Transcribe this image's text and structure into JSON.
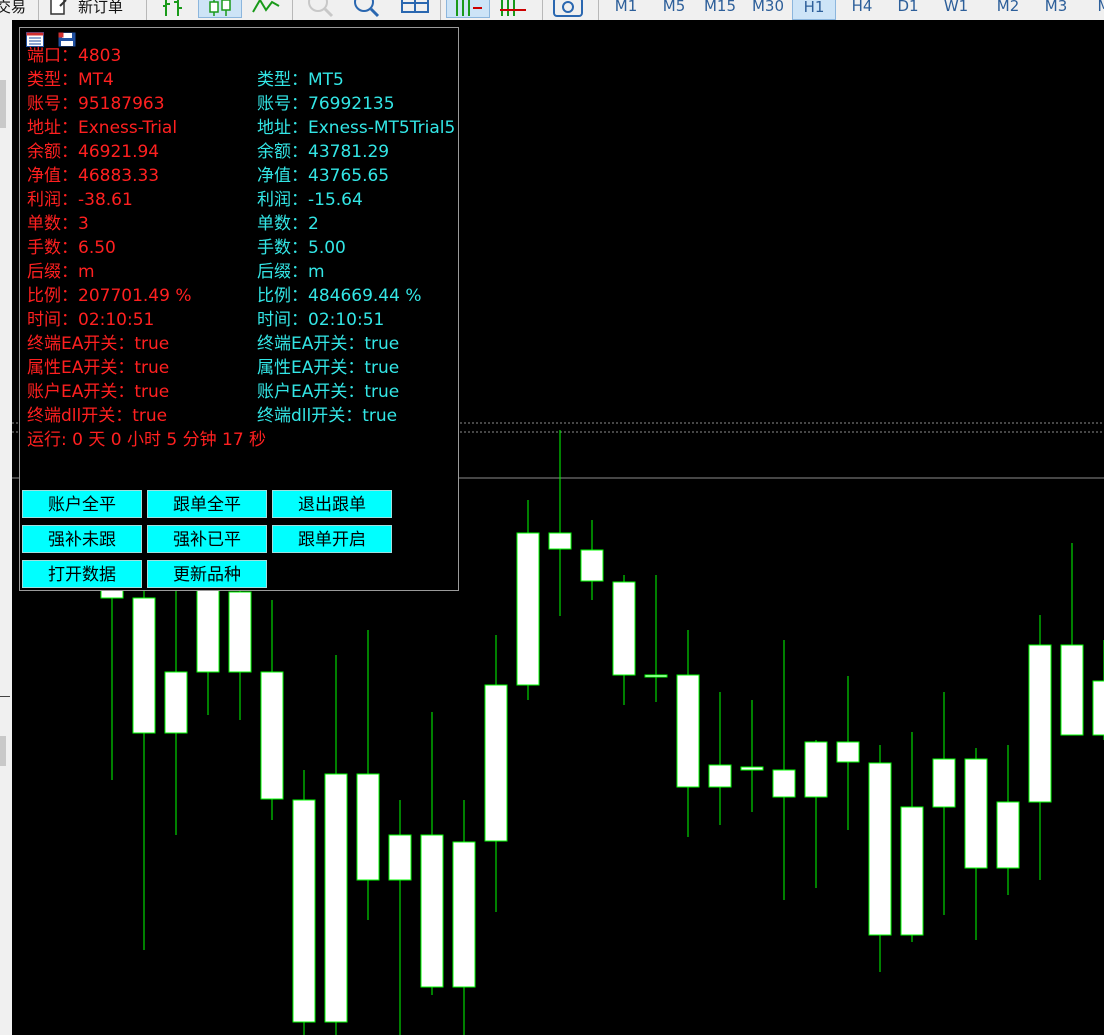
{
  "toolbar": {
    "trade_label": "交易",
    "new_order_label": "新订单",
    "timeframes": [
      "M1",
      "M5",
      "M15",
      "M30",
      "H1",
      "H4",
      "D1",
      "W1",
      "M2",
      "M3",
      "M"
    ],
    "active_timeframe": "H1"
  },
  "colors": {
    "bg": "#000000",
    "candle_body": "#ffffff",
    "candle_outline": "#00ff00",
    "wick": "#00ff00",
    "grid_line": "#8c8c8c",
    "left_col": "#ff2020",
    "right_col": "#33e6e6",
    "button_bg": "#00ffff"
  },
  "panel": {
    "left": {
      "port": "端口：4803",
      "type": "类型：MT4",
      "account": "账号：95187963",
      "server": "地址：Exness-Trial",
      "balance": "余额：46921.94",
      "equity": "净值：46883.33",
      "profit": "利润：-38.61",
      "orders": "单数：3",
      "lots": "手数：6.50",
      "suffix": "后缀：m",
      "ratio": "比例：207701.49 %",
      "time": "时间：02:10:51",
      "terminal_ea": "终端EA开关：true",
      "property_ea": "属性EA开关：true",
      "account_ea": "账户EA开关：true",
      "terminal_dll": "终端dll开关：true",
      "runtime": "运行: 0 天 0 小时 5 分钟 17 秒"
    },
    "right": {
      "type": "类型：MT5",
      "account": "账号：76992135",
      "server": "地址：Exness-MT5Trial5",
      "balance": "余额：43781.29",
      "equity": "净值：43765.65",
      "profit": "利润：-15.64",
      "orders": "单数：2",
      "lots": "手数：5.00",
      "suffix": "后缀：m",
      "ratio": "比例：484669.44 %",
      "time": "时间：02:10:51",
      "terminal_ea": "终端EA开关：true",
      "property_ea": "属性EA开关：true",
      "account_ea": "账户EA开关：true",
      "terminal_dll": "终端dll开关：true"
    },
    "buttons": {
      "close_all_account": "账户全平",
      "close_all_follow": "跟单全平",
      "exit_follow": "退出跟单",
      "force_unfollowed": "强补未跟",
      "force_closed": "强补已平",
      "start_follow": "跟单开启",
      "open_data": "打开数据",
      "update_symbols": "更新品种"
    }
  }
}
